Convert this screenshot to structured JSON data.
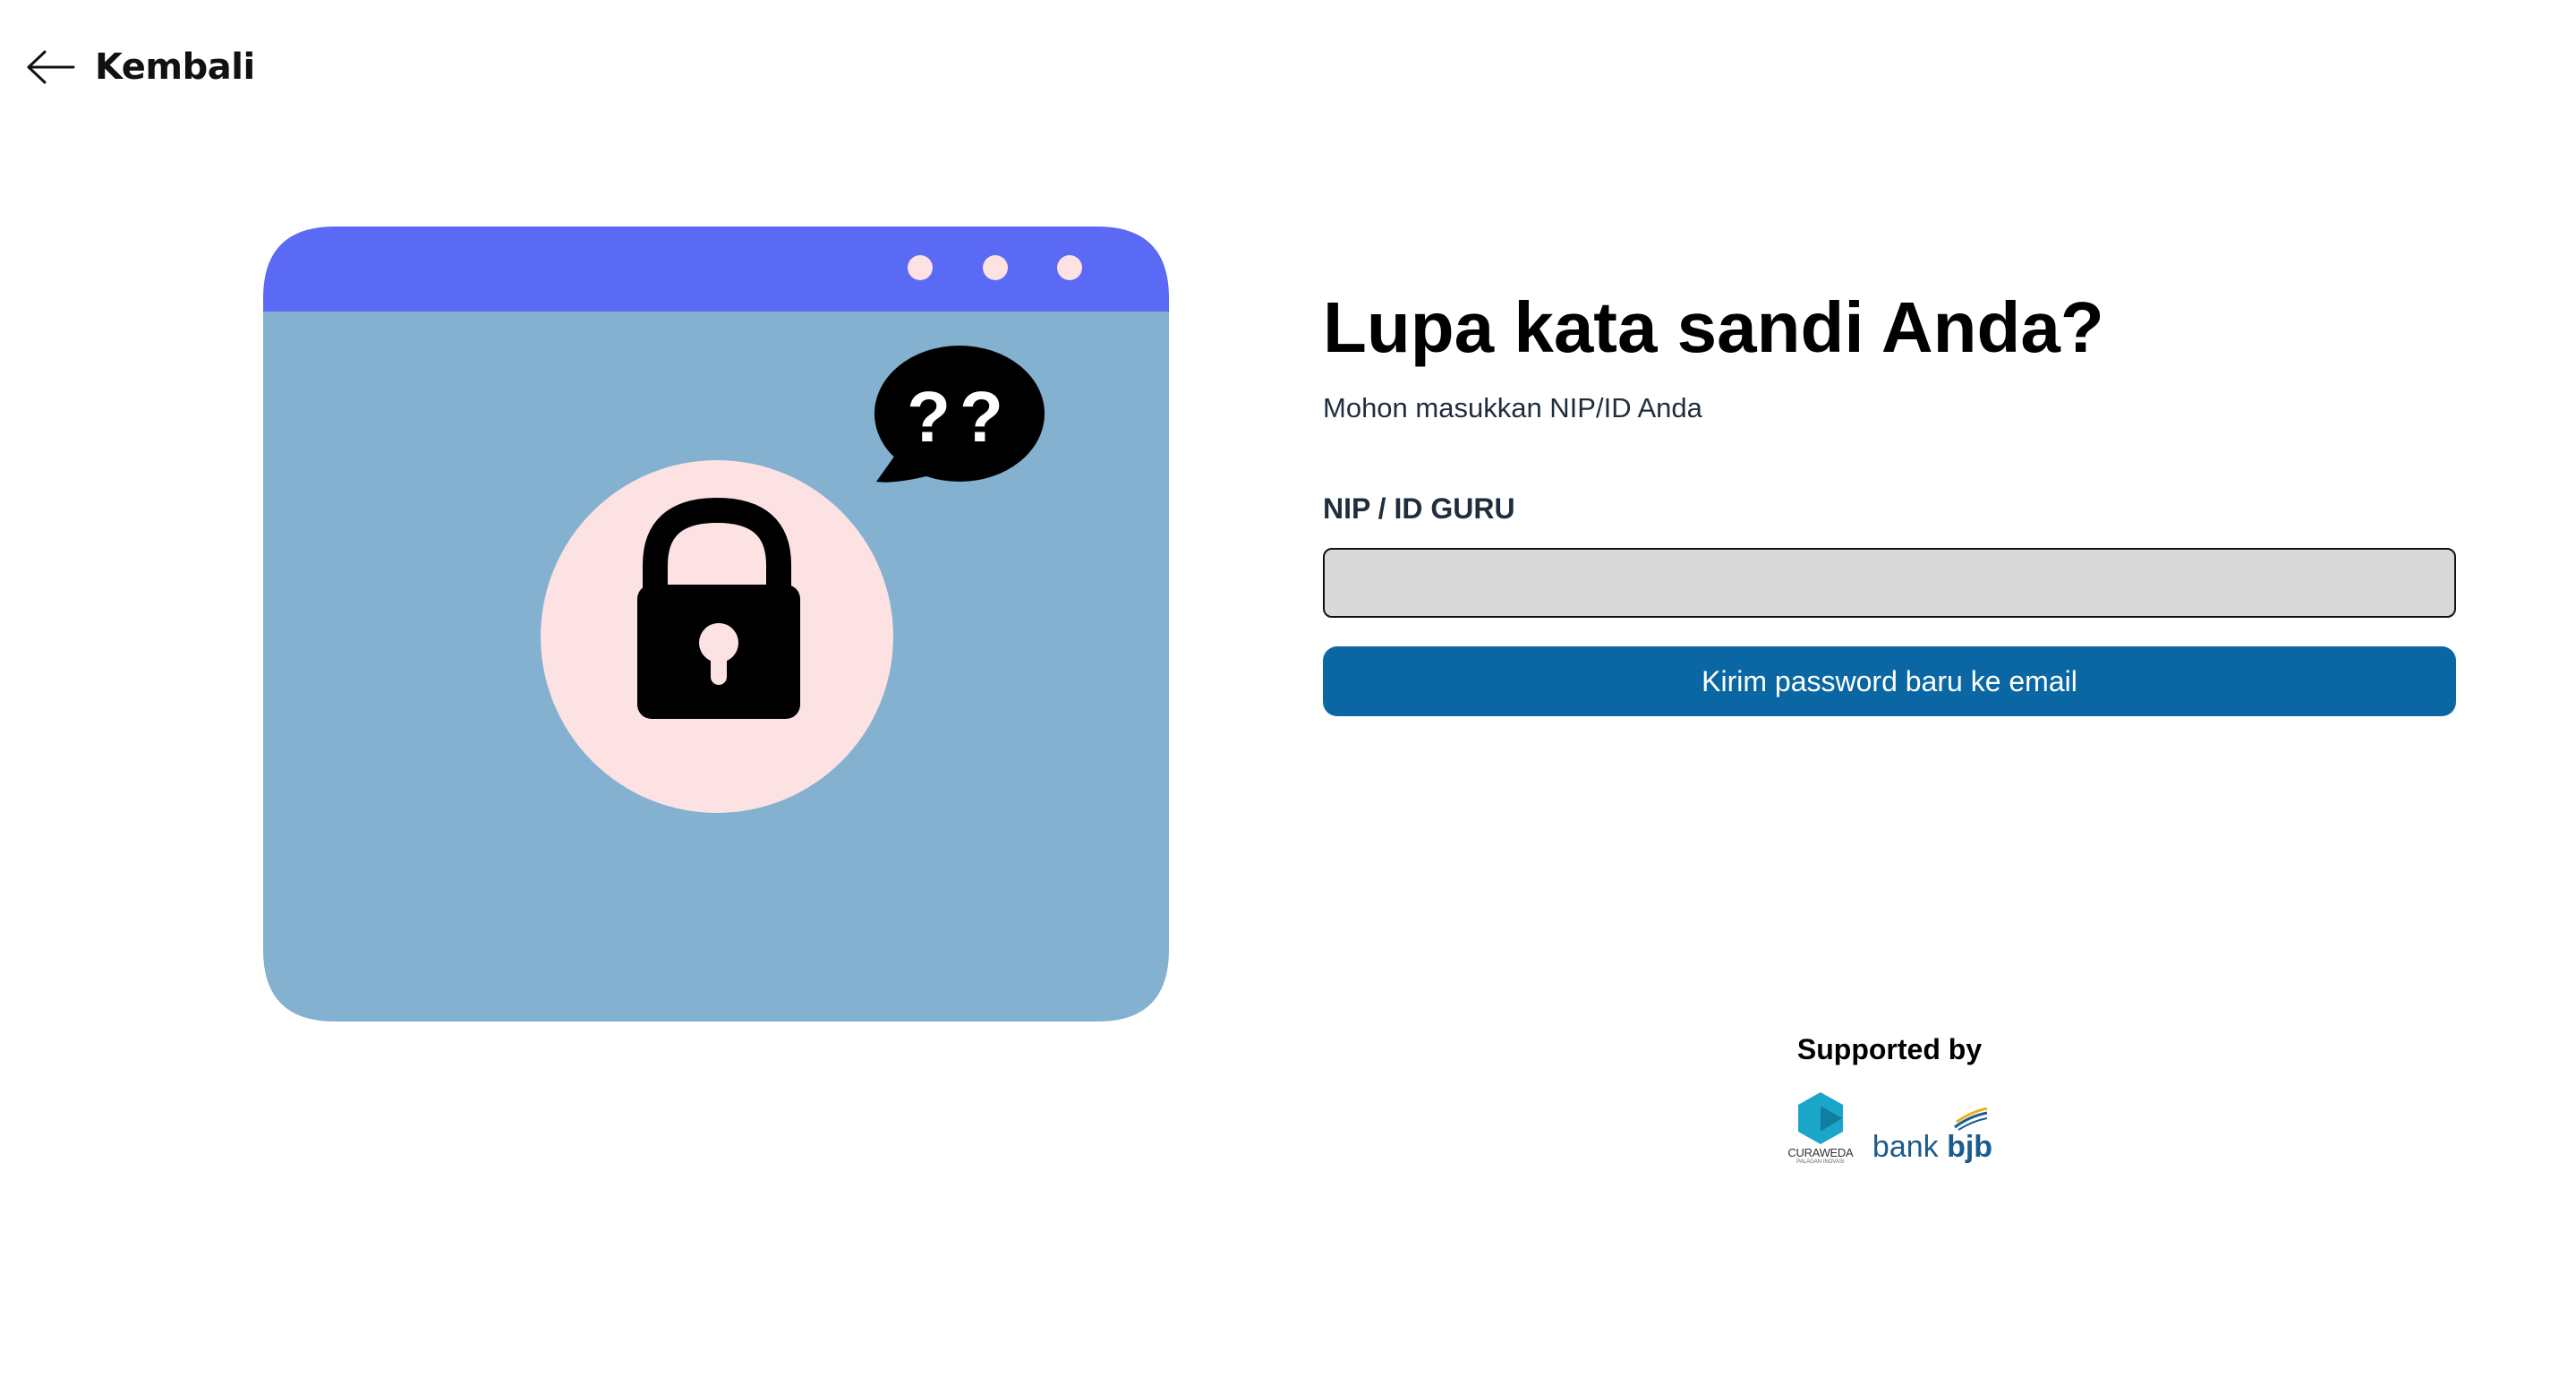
{
  "nav": {
    "back_label": "Kembali",
    "back_icon": "arrow-left-icon"
  },
  "illustration": {
    "question_marks": "??",
    "icons": [
      "lock-icon",
      "speech-bubble-icon"
    ],
    "colors": {
      "window_bar": "#5b6af5",
      "window_body": "#84b1d0",
      "circle": "#fde2e4",
      "dots": "#fde2e4"
    }
  },
  "form": {
    "title": "Lupa kata sandi Anda?",
    "subtitle": "Mohon masukkan NIP/ID Anda",
    "field_label": "NIP / ID GURU",
    "field_value": "",
    "field_placeholder": "",
    "submit_label": "Kirim password baru ke email",
    "colors": {
      "button": "#0b67a3",
      "input_bg": "#d9d9d9"
    }
  },
  "footer": {
    "supported_label": "Supported by",
    "logos": {
      "curaweda": {
        "name": "CURAWEDA",
        "tagline": "PALAGAN INOVASI"
      },
      "bjb": {
        "prefix": "bank",
        "name": "bjb"
      }
    }
  }
}
